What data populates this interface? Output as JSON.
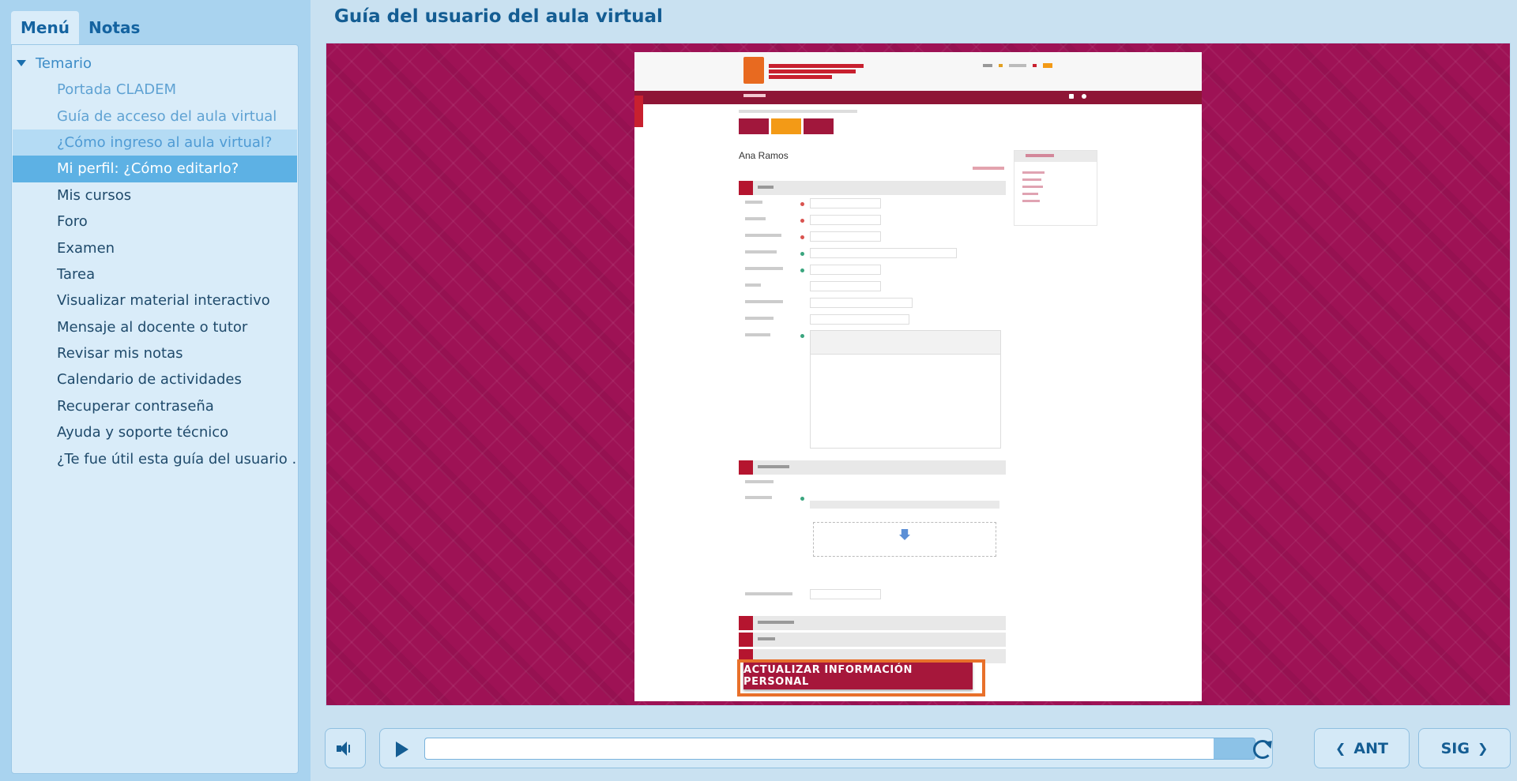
{
  "tabs": {
    "menu": "Menú",
    "notes": "Notas"
  },
  "syllabus": {
    "heading": "Temario",
    "items": [
      {
        "label": "Portada CLADEM",
        "state": "visited"
      },
      {
        "label": "Guía de acceso del aula virtual",
        "state": "visited"
      },
      {
        "label": "¿Cómo ingreso al aula virtual?",
        "state": "hover"
      },
      {
        "label": "Mi perfil: ¿Cómo editarlo?",
        "state": "current"
      },
      {
        "label": "Mis cursos",
        "state": "normal"
      },
      {
        "label": "Foro",
        "state": "normal"
      },
      {
        "label": "Examen",
        "state": "normal"
      },
      {
        "label": "Tarea",
        "state": "normal"
      },
      {
        "label": "Visualizar material interactivo",
        "state": "normal"
      },
      {
        "label": "Mensaje al docente o tutor",
        "state": "normal"
      },
      {
        "label": "Revisar mis notas",
        "state": "normal"
      },
      {
        "label": "Calendario de actividades",
        "state": "normal"
      },
      {
        "label": "Recuperar contraseña",
        "state": "normal"
      },
      {
        "label": "Ayuda y soporte técnico",
        "state": "normal"
      },
      {
        "label": "¿Te fue útil esta guía del usuario ...",
        "state": "normal"
      }
    ]
  },
  "page_title": "Guía del usuario del aula virtual",
  "slide": {
    "profile_name": "Ana Ramos",
    "cta_label": "ACTUALIZAR INFORMACIÓN PERSONAL",
    "colors": {
      "background": "#9e1255",
      "brand": "#a6173b",
      "highlight": "#e8702a"
    }
  },
  "player": {
    "progress": 0.95,
    "prev_label": "ANT",
    "next_label": "SIG",
    "icons": [
      "speaker-icon",
      "play-icon",
      "replay-icon",
      "chevron-left-icon",
      "chevron-right-icon"
    ]
  }
}
